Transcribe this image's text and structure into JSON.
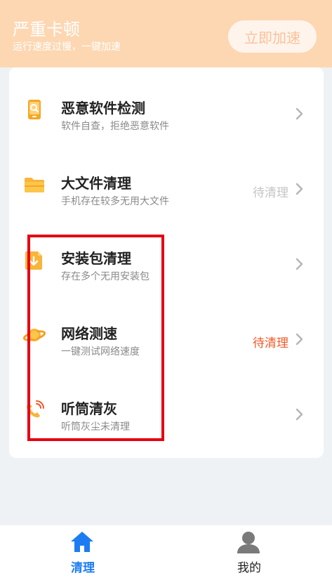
{
  "header": {
    "title": "严重卡顿",
    "subtitle": "运行速度过慢，一键加速",
    "boost_label": "立即加速"
  },
  "items": [
    {
      "title": "恶意软件检测",
      "desc": "软件自查，拒绝恶意软件",
      "status": "",
      "icon": "phone-search-icon"
    },
    {
      "title": "大文件清理",
      "desc": "手机存在较多无用大文件",
      "status": "待清理",
      "icon": "folder-icon"
    },
    {
      "title": "安装包清理",
      "desc": "存在多个无用安装包",
      "status": "",
      "icon": "package-download-icon"
    },
    {
      "title": "网络测速",
      "desc": "一键测试网络速度",
      "status": "待清理",
      "icon": "planet-icon"
    },
    {
      "title": "听筒清灰",
      "desc": "听筒灰尘未清理",
      "status": "",
      "icon": "phone-handset-icon"
    }
  ],
  "status_colors": {
    "muted": "#c4c4c4",
    "alert": "#f05a28"
  },
  "tabs": [
    {
      "label": "清理",
      "active": true,
      "icon": "home-icon"
    },
    {
      "label": "我的",
      "active": false,
      "icon": "user-icon"
    }
  ]
}
